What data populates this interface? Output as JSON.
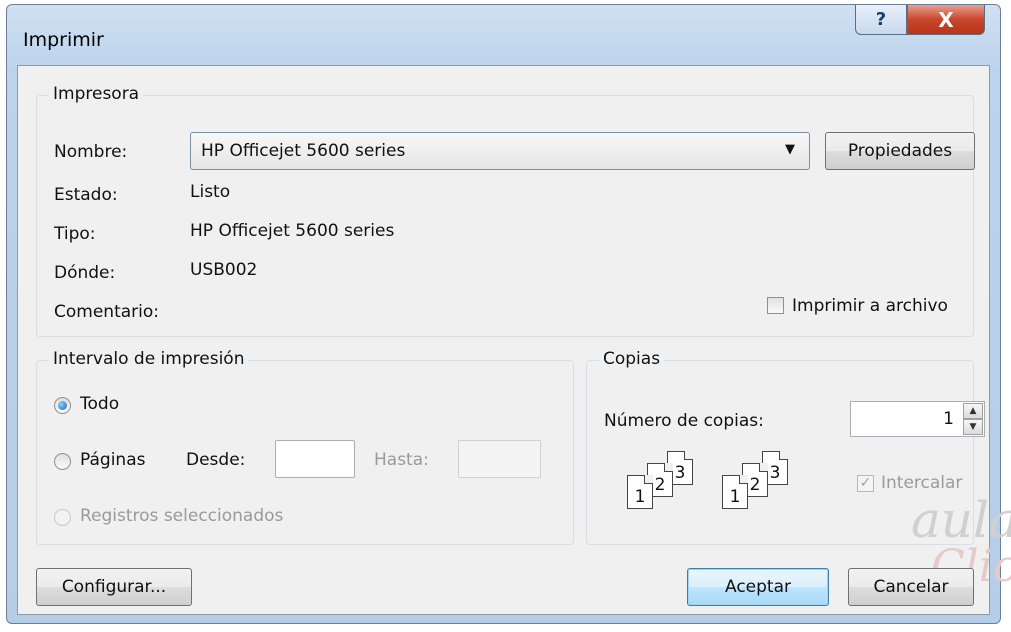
{
  "window": {
    "title": "Imprimir"
  },
  "titlebar": {
    "help_glyph": "?",
    "close_glyph": "X"
  },
  "printer": {
    "group_title": "Impresora",
    "name_label": "Nombre:",
    "name_value": "HP Officejet 5600 series",
    "properties_button": "Propiedades",
    "status_label": "Estado:",
    "status_value": "Listo",
    "type_label": "Tipo:",
    "type_value": "HP Officejet 5600 series",
    "where_label": "Dónde:",
    "where_value": "USB002",
    "comment_label": "Comentario:",
    "print_to_file_label": "Imprimir a archivo",
    "print_to_file_checked": false
  },
  "range": {
    "group_title": "Intervalo de impresión",
    "all_label": "Todo",
    "pages_label": "Páginas",
    "from_label": "Desde:",
    "from_value": "",
    "to_label": "Hasta:",
    "to_value": "",
    "selected_records_label": "Registros seleccionados",
    "selected_option": "Todo"
  },
  "copies": {
    "group_title": "Copias",
    "number_label": "Número de copias:",
    "number_value": "1",
    "collate_label": "Intercalar",
    "collate_checked": true,
    "page_numbers": [
      "1",
      "2",
      "3"
    ]
  },
  "footer": {
    "setup_button": "Configurar...",
    "ok_button": "Aceptar",
    "cancel_button": "Cancelar"
  },
  "watermark": {
    "line1": "aula",
    "line2": "Clic"
  },
  "icons": {
    "help": "help-icon",
    "close": "close-icon",
    "dropdown": "chevron-down-icon",
    "spin_up": "spin-up-icon",
    "spin_down": "spin-down-icon",
    "collate": "collate-pages-icon"
  },
  "colors": {
    "frame": "#bcd3ec",
    "client": "#f0f0f0",
    "close_button": "#c9462c",
    "default_button": "#bee6fd"
  }
}
